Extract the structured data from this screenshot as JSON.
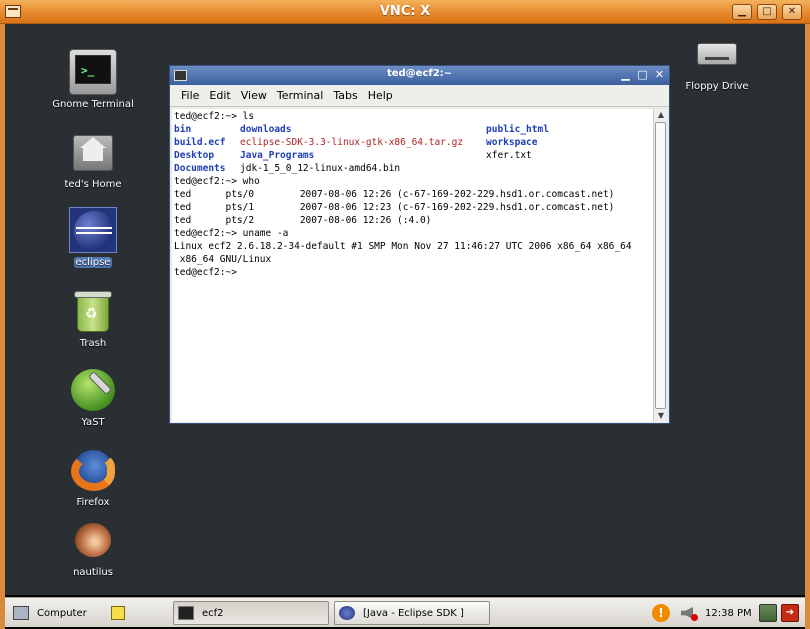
{
  "vnc": {
    "title": "VNC: X",
    "controls": {
      "minimize": "▁",
      "maximize": "□",
      "close": "✕"
    }
  },
  "desktop_icons": [
    {
      "name": "gnome-terminal",
      "label": "Gnome Terminal",
      "icon": "terminal-icon"
    },
    {
      "name": "teds-home",
      "label": "ted's Home",
      "icon": "home-folder-icon"
    },
    {
      "name": "eclipse",
      "label": "eclipse",
      "icon": "eclipse-icon",
      "selected": true
    },
    {
      "name": "trash",
      "label": "Trash",
      "icon": "trash-icon"
    },
    {
      "name": "yast",
      "label": "YaST",
      "icon": "yast-icon"
    },
    {
      "name": "firefox",
      "label": "Firefox",
      "icon": "firefox-icon"
    },
    {
      "name": "nautilus",
      "label": "nautilus",
      "icon": "nautilus-icon"
    },
    {
      "name": "floppy-drive",
      "label": "Floppy Drive",
      "icon": "floppy-drive-icon"
    }
  ],
  "terminal": {
    "title": "ted@ecf2:~",
    "menu": [
      "File",
      "Edit",
      "View",
      "Terminal",
      "Tabs",
      "Help"
    ],
    "lines": {
      "l1": "ted@ecf2:~> ls",
      "ls_row1": [
        "bin",
        "downloads",
        "public_html"
      ],
      "ls_row2": [
        "build.ecf",
        "eclipse-SDK-3.3-linux-gtk-x86_64.tar.gz",
        "workspace"
      ],
      "ls_row3": [
        "Desktop",
        "Java_Programs",
        "xfer.txt"
      ],
      "ls_row4": [
        "Documents",
        "jdk-1_5_0_12-linux-amd64.bin"
      ],
      "l6": "ted@ecf2:~> who",
      "who1": "ted      pts/0        2007-08-06 12:26 (c-67-169-202-229.hsd1.or.comcast.net)",
      "who2": "ted      pts/1        2007-08-06 12:23 (c-67-169-202-229.hsd1.or.comcast.net)",
      "who3": "ted      pts/2        2007-08-06 12:26 (:4.0)",
      "l10": "ted@ecf2:~> uname -a",
      "l11": "Linux ecf2 2.6.18.2-34-default #1 SMP Mon Nov 27 11:46:27 UTC 2006 x86_64 x86_64",
      "l12": " x86_64 GNU/Linux",
      "l13": "ted@ecf2:~> "
    }
  },
  "taskbar": {
    "computer": "Computer",
    "tasks": [
      {
        "label": "ecf2",
        "icon": "terminal-icon",
        "active": true
      },
      {
        "label": "[Java - Eclipse SDK ]",
        "icon": "eclipse-icon",
        "active": false
      }
    ],
    "clock": "12:38 PM"
  }
}
